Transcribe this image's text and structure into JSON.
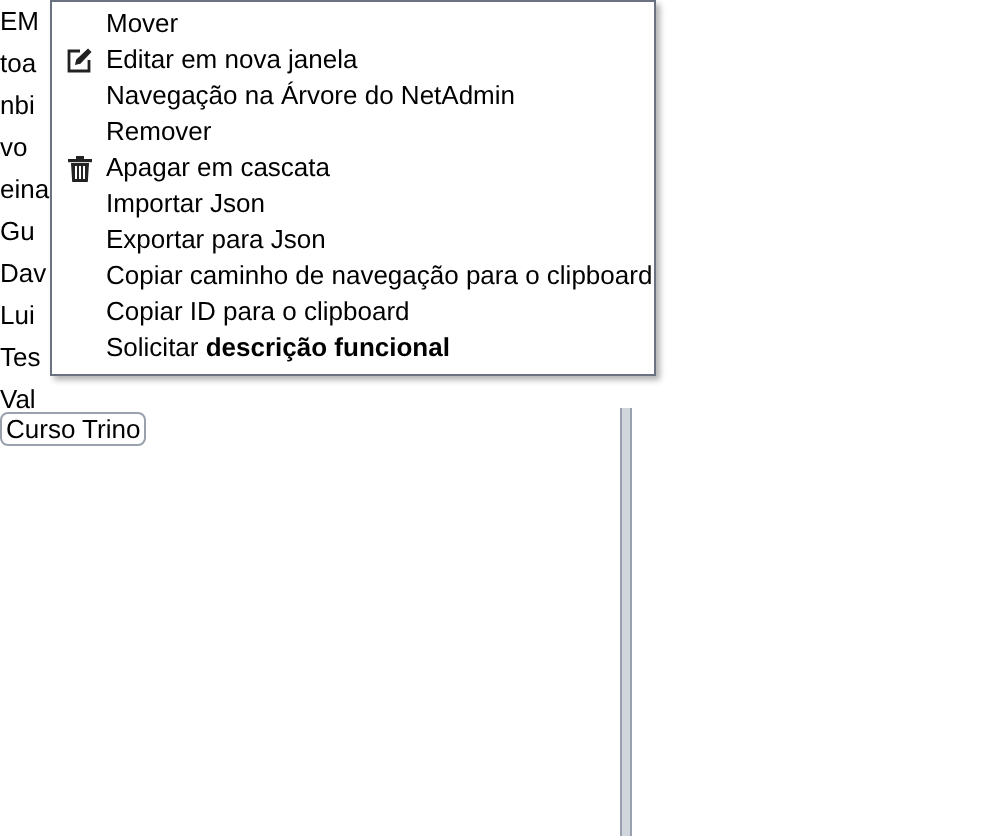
{
  "list": [
    "EM",
    "toa",
    "nbi",
    "vo",
    "eina",
    "Gu",
    "Dav",
    "Lui",
    "Tes",
    "Val"
  ],
  "button": "Curso Trino",
  "context_menu": [
    {
      "label": "Mover"
    },
    {
      "label": "Editar em nova janela",
      "kind": "edit"
    },
    {
      "label": "Navegação na Árvore do NetAdmin"
    },
    {
      "label": "Remover"
    },
    {
      "label": "Apagar em cascata",
      "kind": "trash"
    },
    {
      "label": "Importar Json"
    },
    {
      "label": "Exportar para Json"
    },
    {
      "label": "Copiar caminho de navegação para o clipboard"
    },
    {
      "label": "Copiar ID para o clipboard"
    },
    {
      "label": "Solicitar **descrição funcional**"
    }
  ]
}
